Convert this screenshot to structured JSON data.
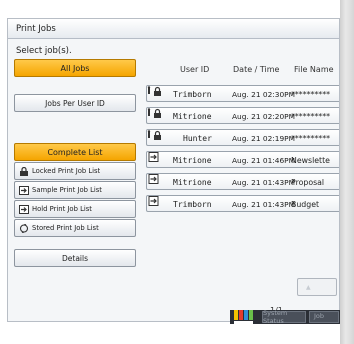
{
  "header": {
    "title": "Print Jobs"
  },
  "prompt": "Select job(s).",
  "left_panel": {
    "all_jobs": "All Jobs",
    "jobs_per_user_id": "Jobs Per User ID",
    "complete_list": "Complete List",
    "locked_print_job_list": "Locked Print Job List",
    "sample_print_job_list": "Sample Print Job List",
    "hold_print_job_list": "Hold Print Job List",
    "stored_print_job_list": "Stored Print Job List",
    "details": "Details"
  },
  "table": {
    "columns": [
      "User ID",
      "Date / Time",
      "File Name"
    ],
    "rows": [
      {
        "type": "locked",
        "user_id": "Trimborn",
        "date_time": "Aug. 21 02:30PM",
        "file_name": "**********"
      },
      {
        "type": "locked",
        "user_id": "Mitrione",
        "date_time": "Aug. 21 02:20PM",
        "file_name": "**********"
      },
      {
        "type": "locked",
        "user_id": "Hunter",
        "date_time": "Aug. 21 02:19PM",
        "file_name": "**********"
      },
      {
        "type": "sample",
        "user_id": "Mitrione",
        "date_time": "Aug. 21 01:46PM",
        "file_name": "Newslette"
      },
      {
        "type": "sample",
        "user_id": "Mitrione",
        "date_time": "Aug. 21 01:43PM",
        "file_name": "Proposal"
      },
      {
        "type": "sample",
        "user_id": "Trimborn",
        "date_time": "Aug. 21 01:43PM",
        "file_name": "Budget"
      }
    ]
  },
  "pager": {
    "page": "1/1"
  },
  "footer": {
    "system_status": "System Status",
    "job_list": "Job"
  },
  "colors": {
    "accent": "#f5a500",
    "status_bar": "#2b2f36"
  }
}
